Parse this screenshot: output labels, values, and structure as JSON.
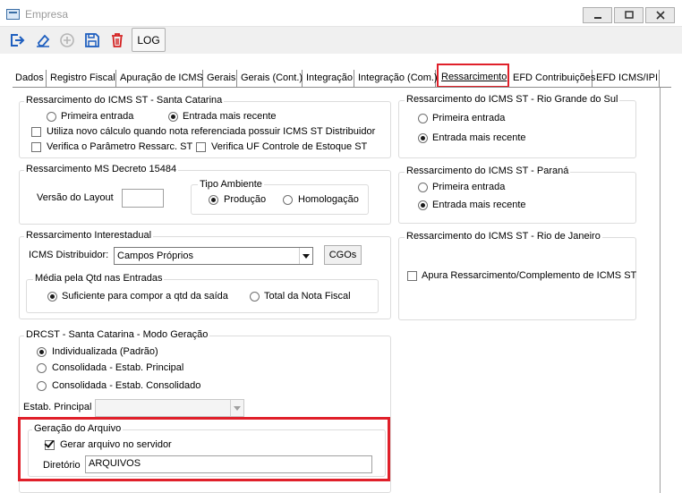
{
  "window": {
    "title": "Empresa"
  },
  "toolbar": {
    "log_label": "LOG"
  },
  "tabs": [
    {
      "label": "Dados"
    },
    {
      "label": "Registro Fiscal"
    },
    {
      "label": "Apuração de ICMS"
    },
    {
      "label": "Gerais"
    },
    {
      "label": "Gerais (Cont.)"
    },
    {
      "label": "Integração"
    },
    {
      "label": "Integração (Com.)"
    },
    {
      "label": "Ressarcimento",
      "active": true
    },
    {
      "label": "EFD Contribuições"
    },
    {
      "label": "EFD ICMS/IPI"
    }
  ],
  "sc": {
    "title": "Ressarcimento do ICMS ST - Santa Catarina",
    "radio1": "Primeira entrada",
    "radio2": "Entrada mais recente",
    "selected": "Entrada mais recente",
    "check1": "Utiliza novo cálculo quando nota referenciada possuir ICMS ST Distribuidor",
    "check2": "Verifica o Parâmetro Ressarc. ST",
    "check3": "Verifica UF Controle de Estoque ST"
  },
  "ms": {
    "title": "Ressarcimento MS Decreto 15484",
    "version_label": "Versão do Layout",
    "version_value": "",
    "ambiente_title": "Tipo Ambiente",
    "radio1": "Produção",
    "radio2": "Homologação",
    "selected": "Produção"
  },
  "inter": {
    "title": "Ressarcimento Interestadual",
    "dist_label": "ICMS Distribuidor:",
    "dist_value": "Campos Próprios",
    "cgos_label": "CGOs",
    "media_title": "Média pela Qtd nas Entradas",
    "radio1": "Suficiente para compor a qtd da saída",
    "radio2": "Total da Nota Fiscal",
    "selected": "Suficiente para compor a qtd da saída"
  },
  "drcst": {
    "title": "DRCST - Santa Catarina - Modo Geração",
    "radio1": "Individualizada (Padrão)",
    "radio2": "Consolidada - Estab. Principal",
    "radio3": "Consolidada - Estab. Consolidado",
    "selected": "Individualizada (Padrão)",
    "estab_label": "Estab. Principal",
    "estab_value": ""
  },
  "arquivo": {
    "title": "Geração do Arquivo",
    "check_label": "Gerar arquivo no servidor",
    "checked": true,
    "dir_label": "Diretório",
    "dir_value": "ARQUIVOS"
  },
  "rs": {
    "title": "Ressarcimento do ICMS ST - Rio Grande do Sul",
    "radio1": "Primeira entrada",
    "radio2": "Entrada mais recente",
    "selected": "Entrada mais recente"
  },
  "pr": {
    "title": "Ressarcimento do ICMS ST - Paraná",
    "radio1": "Primeira entrada",
    "radio2": "Entrada mais recente",
    "selected": "Entrada mais recente"
  },
  "rj": {
    "title": "Ressarcimento do ICMS ST - Rio de Janeiro",
    "check_label": "Apura Ressarcimento/Complemento de ICMS ST",
    "checked": false
  },
  "icons": {
    "exit": "exit-icon",
    "eraser": "eraser-icon",
    "add": "add-icon",
    "save": "save-icon",
    "delete": "delete-icon",
    "minimize": "minimize-icon",
    "maximize": "maximize-icon",
    "close": "close-icon"
  },
  "colors": {
    "highlight": "#e0202a",
    "icon_blue": "#1f5fbf",
    "icon_red": "#d42020"
  }
}
